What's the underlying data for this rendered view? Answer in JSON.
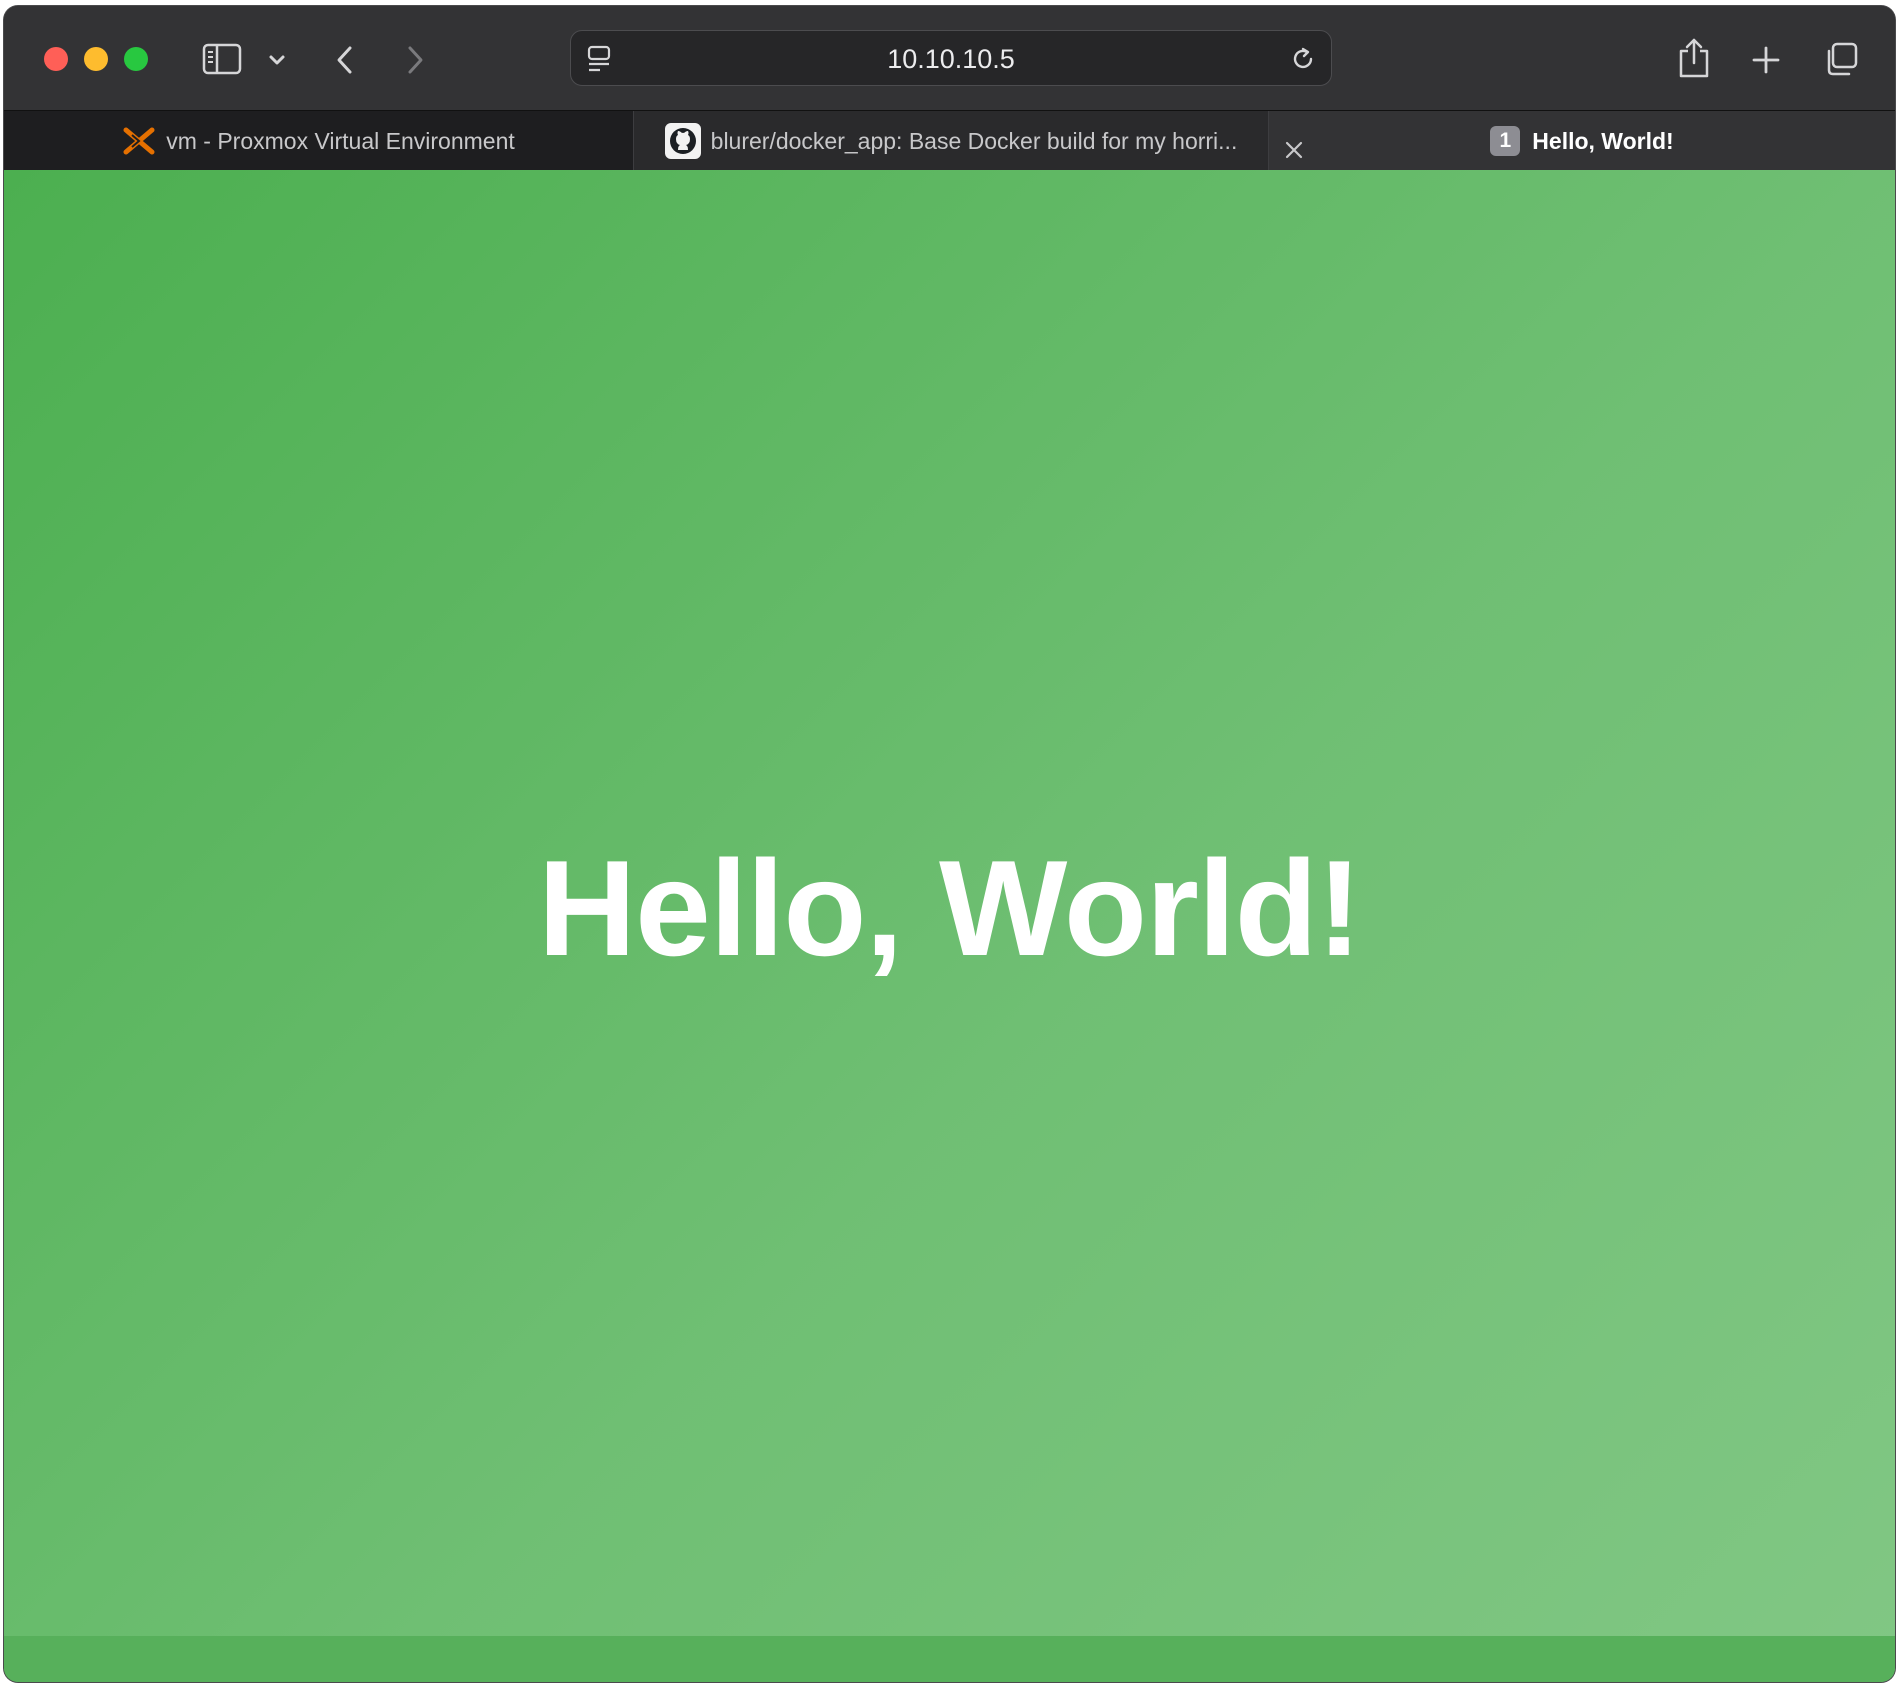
{
  "browser": {
    "address": "10.10.10.5",
    "icons": {
      "close": "close-window",
      "minimize": "minimize-window",
      "maximize": "maximize-window",
      "sidebar": "sidebar-icon",
      "sidebar_menu": "chevron-down-icon",
      "back": "chevron-left-icon",
      "forward": "chevron-right-icon",
      "page_menu": "page-menu-icon",
      "reload": "reload-icon",
      "share": "share-icon",
      "new_tab": "plus-icon",
      "tab_overview": "tabs-overview-icon"
    }
  },
  "tabs": [
    {
      "title": "vm - Proxmox Virtual Environment",
      "favicon": "proxmox-icon"
    },
    {
      "title": "blurer/docker_app: Base Docker build for my horri...",
      "favicon": "github-icon"
    },
    {
      "title": "Hello, World!",
      "badge": "1",
      "active": true
    }
  ],
  "page": {
    "heading": "Hello, World!",
    "colors": {
      "gradient_start": "#4caf50",
      "gradient_end": "#81c784",
      "heading": "#ffffff"
    }
  }
}
